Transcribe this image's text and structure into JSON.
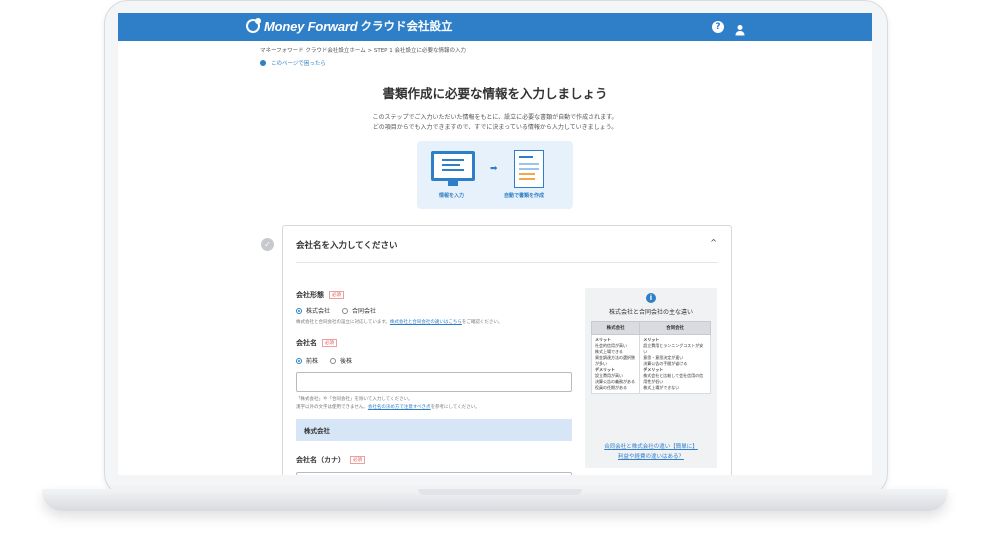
{
  "header": {
    "logo_text": "Money Forward",
    "logo_sub": "クラウド会社設立",
    "help_icon": "?"
  },
  "breadcrumb": "マネーフォワード クラウド会社設立ホーム > STEP 1 会社設立に必要な情報の入力",
  "help_link": "このページで困ったら",
  "page_title": "書類作成に必要な情報を入力しましょう",
  "intro": {
    "line1": "このステップでご入力いただいた情報をもとに、設立に必要な書類が自動で作成されます。",
    "line2": "どの項目からでも入力できますので、すでに決まっている情報から入力していきましょう。"
  },
  "illustration": {
    "caption_left": "情報を入力",
    "caption_right": "自動で書類を作成",
    "arrow": "➡"
  },
  "panel": {
    "title": "会社名を入力してください",
    "chevron": "^",
    "required_badge": "必須",
    "company_type": {
      "label": "会社形態",
      "options": [
        "株式会社",
        "合同会社"
      ],
      "selected": "株式会社",
      "note_prefix": "株式会社と合同会社の設立に対応しています。",
      "note_link": "株式会社と合同会社の違いはこちら",
      "note_suffix": "をご確認ください。"
    },
    "company_name": {
      "label": "会社名",
      "options": [
        "前株",
        "後株"
      ],
      "selected": "前株",
      "input_value": "",
      "note1": "「株式会社」や「合同会社」を除いて入力してください。",
      "note2_prefix": "漢字以外の文字は使用できません。",
      "note2_link": "会社名の決め方で注意すべき点",
      "note2_suffix": "を参考にしてください。",
      "preview": "株式会社"
    },
    "company_name_kana": {
      "label": "会社名（カナ）",
      "input_value": ""
    }
  },
  "side_box": {
    "info_icon": "i",
    "title": "株式会社と合同会社の主な違い",
    "col1": "株式会社",
    "col2": "合同会社",
    "merit_label": "メリット",
    "demerit_label": "デメリット",
    "kabushiki_merits": [
      "社会的信用が高い",
      "株式上場できる",
      "資金調達方法の選択肢が多い"
    ],
    "kabushiki_demerits": [
      "設立費用が高い",
      "決算公告の義務がある",
      "役員の任期がある"
    ],
    "godo_merits": [
      "設立費用とランニングコストが安い",
      "意思・意思決定が速い",
      "決算公告の手間が省ける"
    ],
    "godo_demerits": [
      "株式会社と比較して会社信用の信用性が低い",
      "株式上場ができない"
    ],
    "link1": "合同会社と株式会社の違い【簡単に】",
    "link2": "利益や経費の違いはある？"
  },
  "colors": {
    "brand": "#2f7fc8",
    "required": "#e05050",
    "preview_bg": "#d7e6f7"
  }
}
